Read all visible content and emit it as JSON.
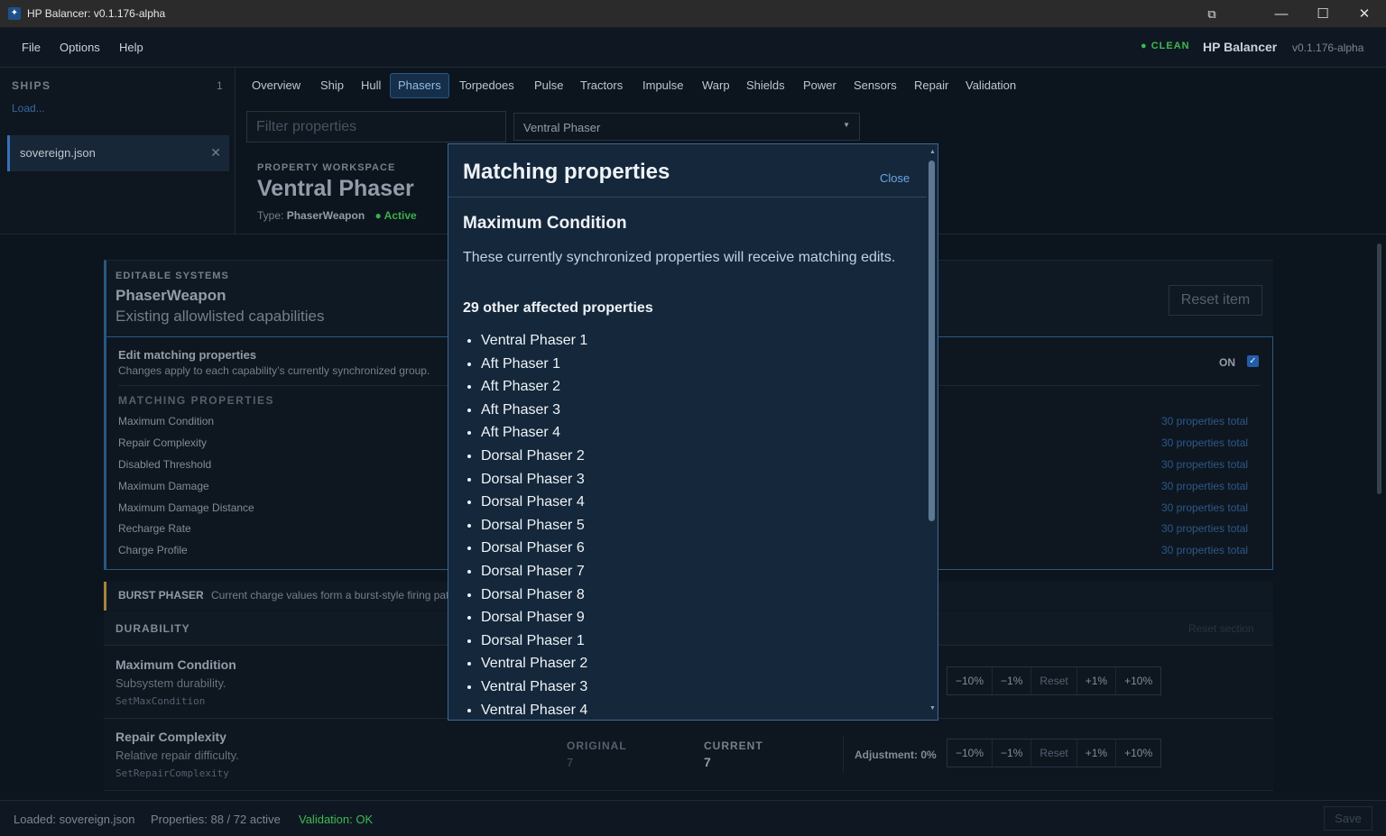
{
  "window": {
    "title": "HP Balancer: v0.1.176-alpha",
    "controls": {
      "restore": "⧉",
      "minimize": "—",
      "maximize": "☐",
      "close": "✕"
    }
  },
  "menu": {
    "items": [
      "File",
      "Options",
      "Help"
    ],
    "status": "CLEAN",
    "brand": "HP Balancer",
    "version": "v0.1.176-alpha"
  },
  "sidebar": {
    "title": "SHIPS",
    "count": "1",
    "load": "Load...",
    "file": "sovereign.json",
    "remove": "✕"
  },
  "tabs": [
    {
      "label": "Overview"
    },
    {
      "label": "Ship"
    },
    {
      "label": "Hull"
    },
    {
      "label": "Phasers",
      "active": true
    },
    {
      "label": "Torpedoes"
    },
    {
      "label": "Pulse"
    },
    {
      "label": "Tractors"
    },
    {
      "label": "Impulse"
    },
    {
      "label": "Warp"
    },
    {
      "label": "Shields"
    },
    {
      "label": "Power"
    },
    {
      "label": "Sensors"
    },
    {
      "label": "Repair"
    },
    {
      "label": "Validation"
    }
  ],
  "filter": {
    "placeholder": "Filter properties"
  },
  "item_select": {
    "value": "Ventral Phaser"
  },
  "workspace": {
    "label": "PROPERTY WORKSPACE",
    "title": "Ventral Phaser",
    "type_label": "Type:",
    "type_value": "PhaserWeapon",
    "state": "Active"
  },
  "systems": {
    "label": "EDITABLE SYSTEMS",
    "title": "PhaserWeapon",
    "subtitle": "Existing allowlisted capabilities",
    "reset": "Reset item"
  },
  "matching": {
    "title": "Edit matching properties",
    "subtitle": "Changes apply to each capability’s currently synchronized group.",
    "toggle_label": "ON",
    "toggle_on": true,
    "heading": "MATCHING PROPERTIES",
    "rows": [
      {
        "name": "Maximum Condition",
        "total": "30 properties total"
      },
      {
        "name": "Repair Complexity",
        "total": "30 properties total"
      },
      {
        "name": "Disabled Threshold",
        "total": "30 properties total"
      },
      {
        "name": "Maximum Damage",
        "total": "30 properties total"
      },
      {
        "name": "Maximum Damage Distance",
        "total": "30 properties total"
      },
      {
        "name": "Recharge Rate",
        "total": "30 properties total"
      },
      {
        "name": "Charge Profile",
        "total": "30 properties total"
      }
    ]
  },
  "burst": {
    "label": "BURST PHASER",
    "text": "Current charge values form a burst-style firing pattern."
  },
  "section": {
    "label": "DURABILITY",
    "reset": "Reset section"
  },
  "properties": [
    {
      "name": "Maximum Condition",
      "desc": "Subsystem durability.",
      "code": "SetMaxCondition",
      "buttons": [
        "−10%",
        "−1%",
        "Reset",
        "+1%",
        "+10%"
      ]
    },
    {
      "name": "Repair Complexity",
      "desc": "Relative repair difficulty.",
      "code": "SetRepairComplexity",
      "original_label": "ORIGINAL",
      "original": "7",
      "current_label": "CURRENT",
      "current": "7",
      "adjustment": "Adjustment: 0%",
      "buttons": [
        "−10%",
        "−1%",
        "Reset",
        "+1%",
        "+10%"
      ]
    }
  ],
  "status": {
    "loaded": "Loaded: sovereign.json",
    "properties": "Properties: 88 / 72 active",
    "validation": "Validation: OK",
    "save": "Save"
  },
  "modal": {
    "title": "Matching properties",
    "close": "Close",
    "property": "Maximum Condition",
    "description": "These currently synchronized properties will receive matching edits.",
    "count": "29 other affected properties",
    "items": [
      "Ventral Phaser 1",
      "Aft Phaser 1",
      "Aft Phaser 2",
      "Aft Phaser 3",
      "Aft Phaser 4",
      "Dorsal Phaser 2",
      "Dorsal Phaser 3",
      "Dorsal Phaser 4",
      "Dorsal Phaser 5",
      "Dorsal Phaser 6",
      "Dorsal Phaser 7",
      "Dorsal Phaser 8",
      "Dorsal Phaser 9",
      "Dorsal Phaser 1",
      "Ventral Phaser 2",
      "Ventral Phaser 3",
      "Ventral Phaser 4"
    ]
  },
  "colors": {
    "accent": "#2d5c8a",
    "ok": "#3fb950",
    "link": "#6aa7e8",
    "warning_bar": "#b08a3a"
  }
}
